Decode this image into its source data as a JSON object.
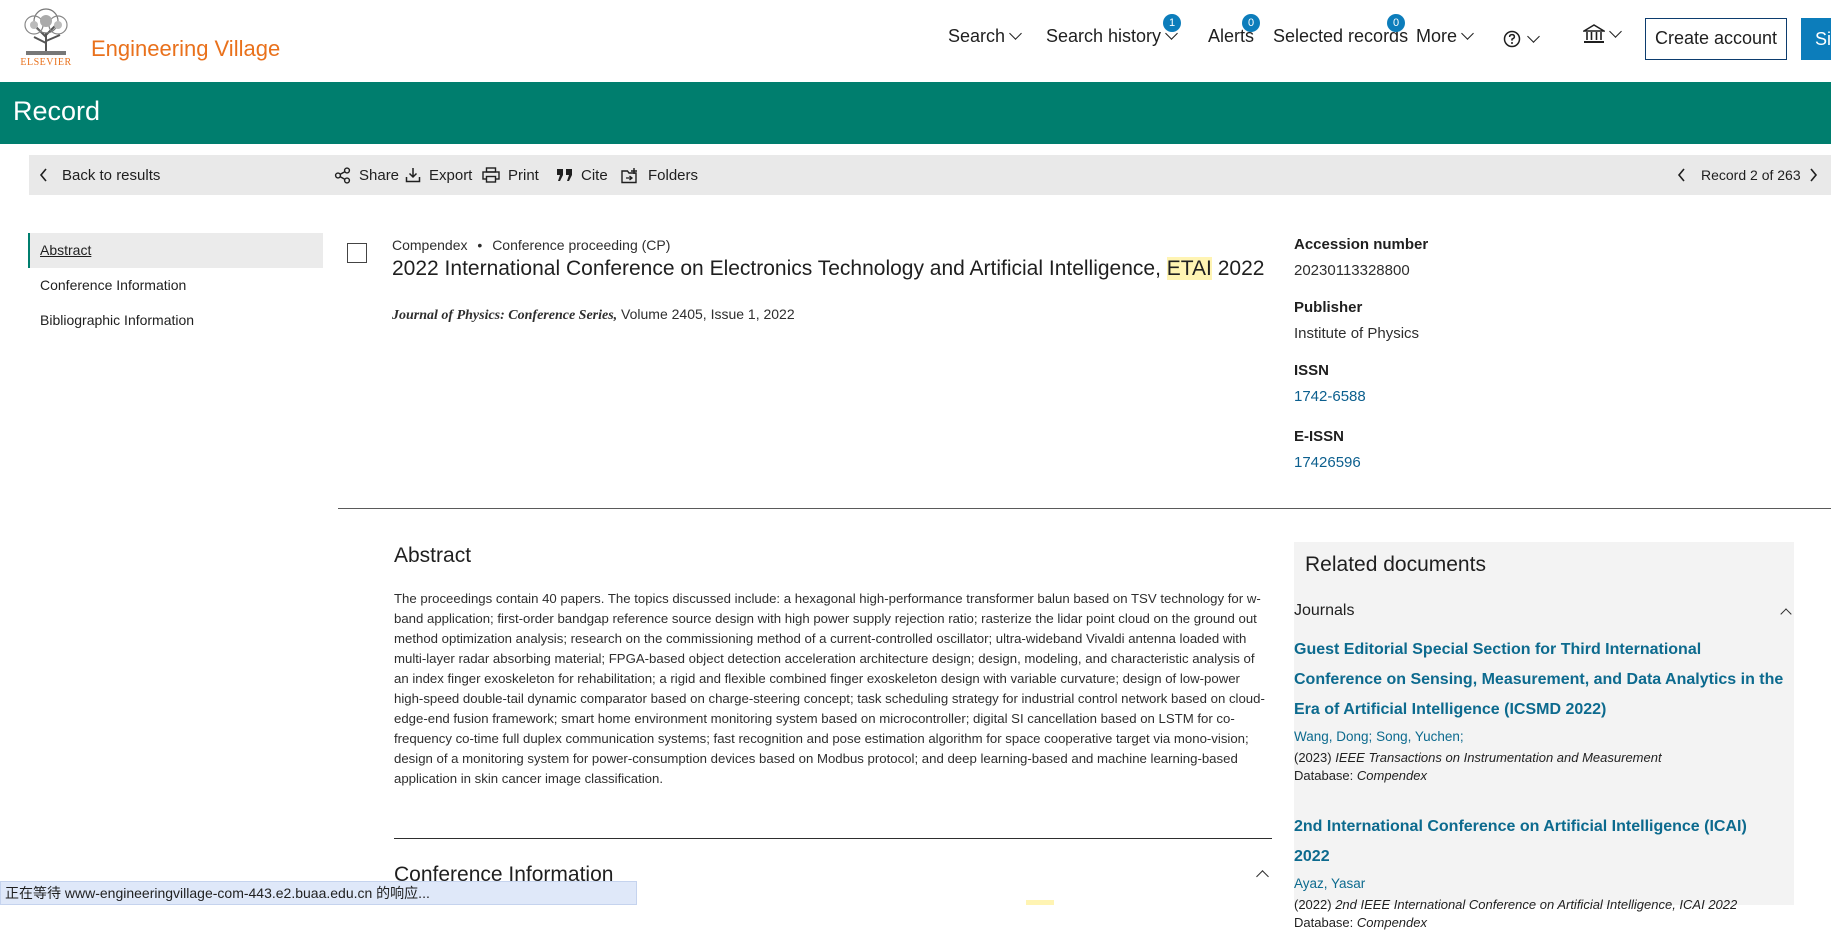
{
  "header": {
    "logo_word": "ELSEVIER",
    "brand": "Engineering Village",
    "nav": {
      "search": "Search",
      "search_history": "Search history",
      "search_history_badge": "1",
      "alerts": "Alerts",
      "alerts_badge": "0",
      "selected_records": "Selected records",
      "selected_badge": "0",
      "more": "More"
    },
    "create_account": "Create account",
    "sign_in": "Si"
  },
  "banner": {
    "title": "Record"
  },
  "toolbar": {
    "back": "Back to results",
    "share": "Share",
    "export": "Export",
    "print": "Print",
    "cite": "Cite",
    "folders": "Folders",
    "record_pos": "Record 2 of 263"
  },
  "leftnav": {
    "items": [
      "Abstract",
      "Conference Information",
      "Bibliographic Information"
    ]
  },
  "record": {
    "database": "Compendex",
    "separator": "•",
    "doc_type": "Conference proceeding (CP)",
    "title_before": "2022 International Conference on Electronics Technology and Artificial Intelligence, ",
    "title_hl": "ETAI",
    "title_after": " 2022",
    "journal": "Journal of Physics: Conference Series,",
    "source_rest": " Volume 2405, Issue 1, 2022"
  },
  "meta": {
    "accession_label": "Accession number",
    "accession_value": "20230113328800",
    "publisher_label": "Publisher",
    "publisher_value": "Institute of Physics",
    "issn_label": "ISSN",
    "issn_value": "1742-6588",
    "eissn_label": "E-ISSN",
    "eissn_value": "17426596"
  },
  "abstract": {
    "title": "Abstract",
    "text": "The proceedings contain 40 papers. The topics discussed include: a hexagonal high-performance transformer balun based on TSV technology for w-band application; first-order bandgap reference source design with high power supply rejection ratio; rasterize the lidar point cloud on the ground out method optimization analysis; research on the commissioning method of a current-controlled oscillator; ultra-wideband Vivaldi antenna loaded with multi-layer radar absorbing material; FPGA-based object detection acceleration architecture design; design, modeling, and characteristic analysis of an index finger exoskeleton for rehabilitation; a rigid and flexible combined finger exoskeleton design with variable curvature; design of low-power high-speed double-tail dynamic comparator based on charge-steering concept; task scheduling strategy for industrial control network based on cloud-edge-end fusion framework; smart home environment monitoring system based on microcontroller; digital SI cancellation based on LSTM for co-frequency co-time full duplex communication systems; fast recognition and pose estimation algorithm for space cooperative target via mono-vision; design of a monitoring system for power-consumption devices based on Modbus protocol; and deep learning-based and machine learning-based application in skin cancer image classification."
  },
  "conference_info": {
    "title": "Conference Information"
  },
  "related": {
    "title": "Related documents",
    "section": "Journals",
    "docs": [
      {
        "title": "Guest Editorial Special Section for Third International Conference on Sensing, Measurement, and Data Analytics in the Era of Artificial Intelligence (ICSMD 2022)",
        "author1": "Wang, Dong;",
        "author2": "Song, Yuchen;",
        "year": "(2023)",
        "venue": "IEEE Transactions on Instrumentation and Measurement",
        "db_label": "Database:",
        "db": "Compendex"
      },
      {
        "title": "2nd International Conference on Artificial Intelligence (ICAI) 2022",
        "author1": "Ayaz, Yasar",
        "year": "(2022)",
        "venue": "2nd IEEE International Conference on Artificial Intelligence, ICAI 2022",
        "db_label": "Database:",
        "db": "Compendex"
      }
    ]
  },
  "statusbar": {
    "text": "正在等待 www-engineeringvillage-com-443.e2.buaa.edu.cn 的响应..."
  },
  "colors": {
    "accent": "#007e6e",
    "brand": "#e9711c",
    "link": "#0c6a8e",
    "badge": "#0c7dbb"
  }
}
